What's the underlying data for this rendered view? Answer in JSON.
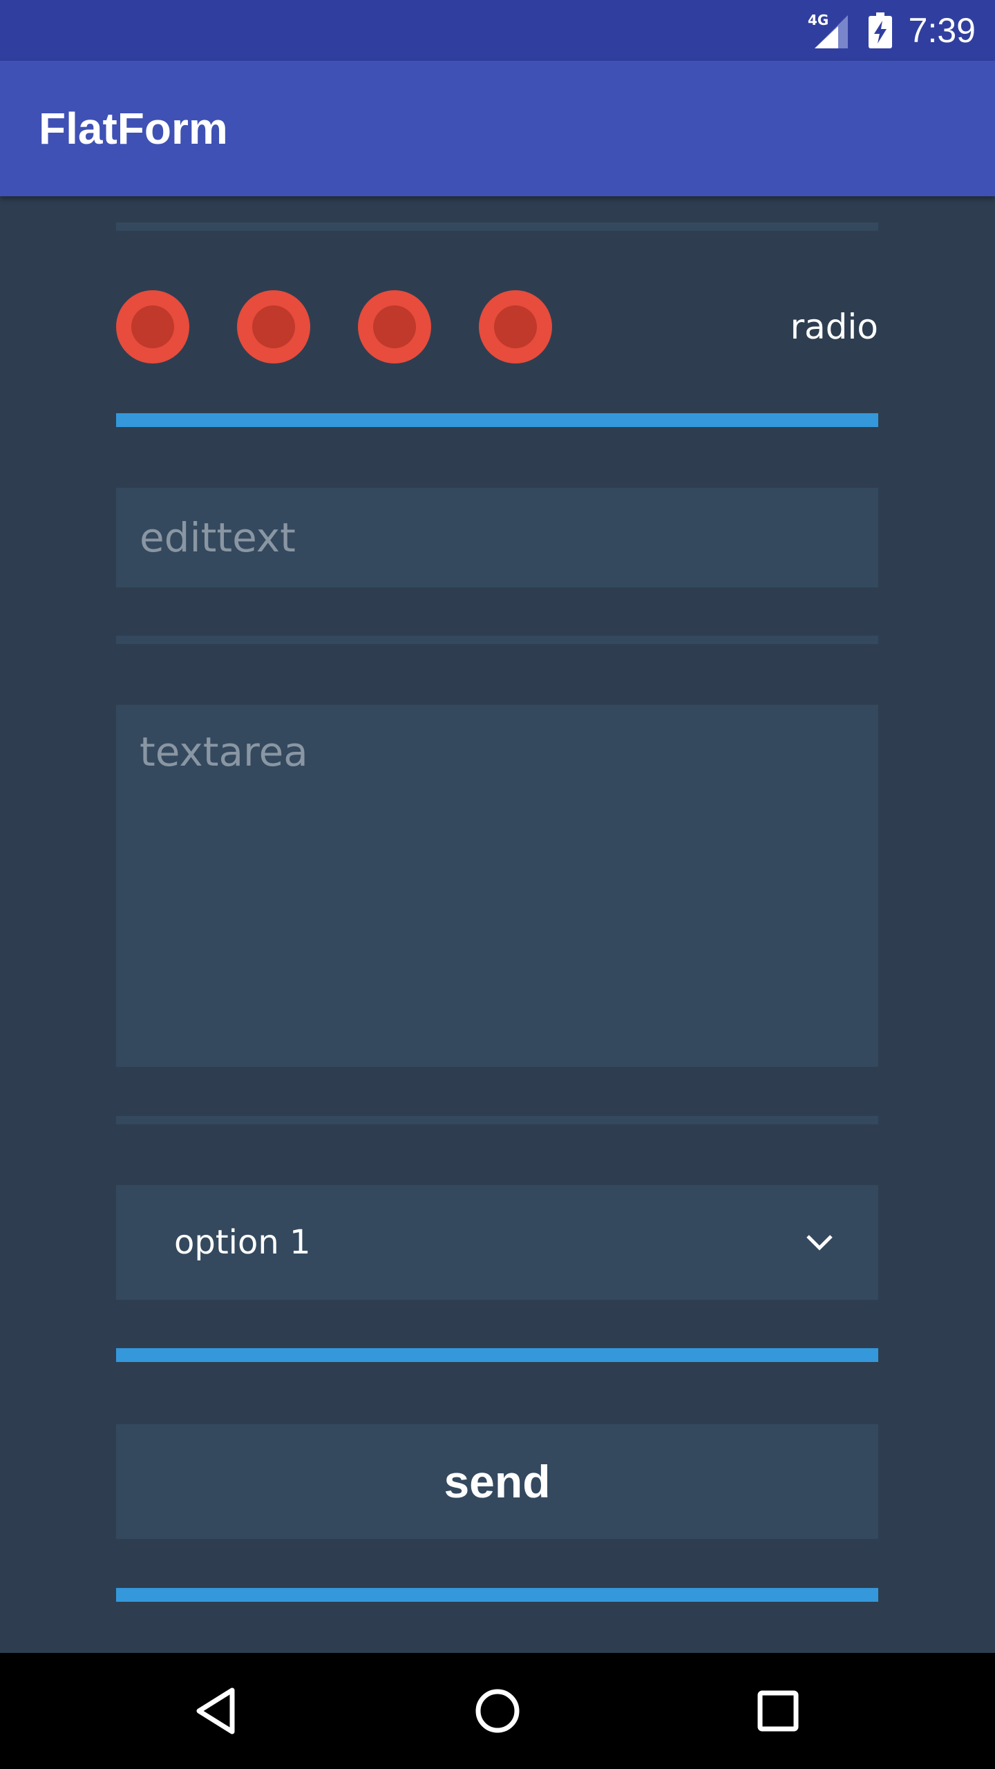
{
  "status_bar": {
    "network": "4G",
    "time": "7:39",
    "icons": [
      "signal-icon",
      "battery-charging-icon"
    ]
  },
  "app_bar": {
    "title": "FlatForm"
  },
  "form": {
    "radio_label": "radio",
    "radio_options_count": 4,
    "edittext_placeholder": "edittext",
    "textarea_placeholder": "textarea",
    "select": {
      "value": "option 1",
      "icon": "chevron-down-icon"
    },
    "send_label": "send"
  },
  "nav_bar": {
    "icons": [
      "back-icon",
      "home-icon",
      "recents-icon"
    ]
  },
  "colors": {
    "status_bar": "#303f9f",
    "app_bar": "#3f51b5",
    "background": "#2e3e50",
    "field": "#34495e",
    "radio": "#e74c3c",
    "radio_inner": "#c0392b",
    "accent": "#3498db"
  }
}
